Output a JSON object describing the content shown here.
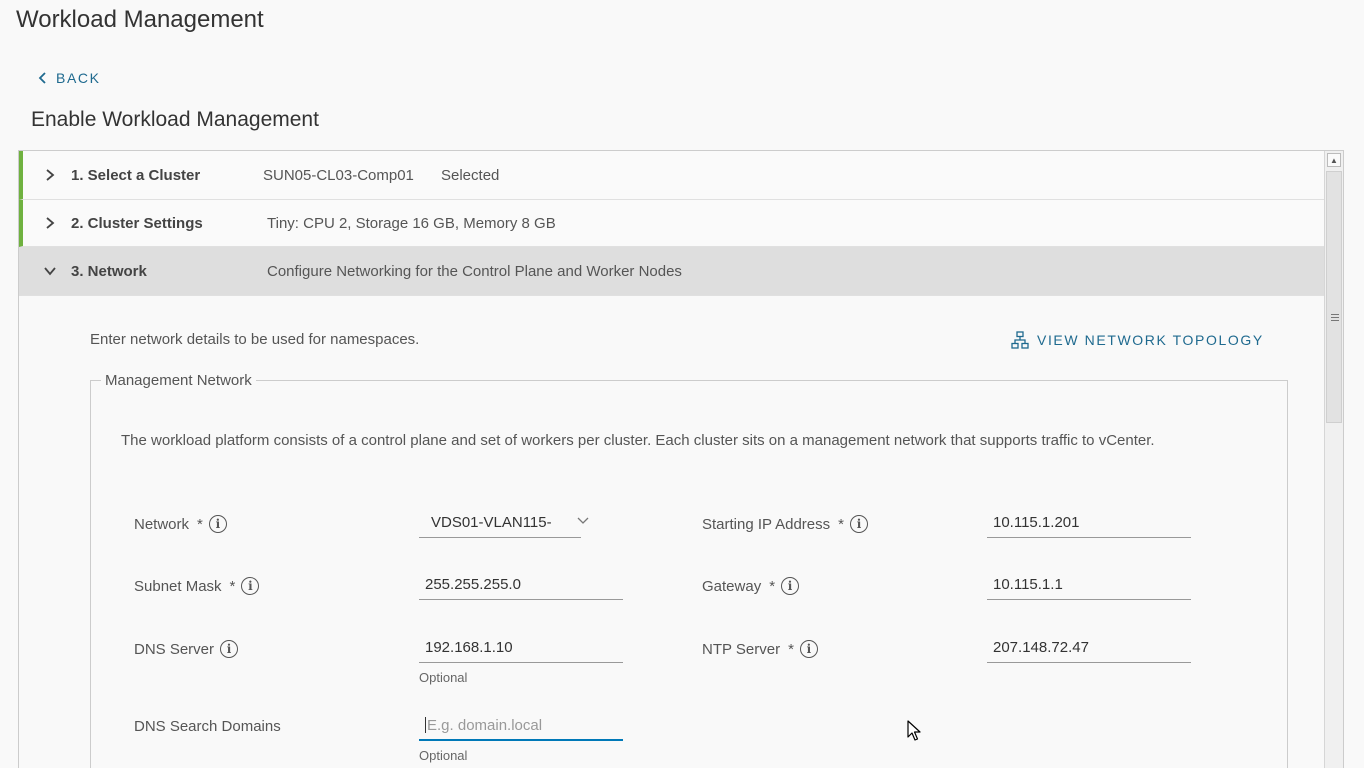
{
  "header": {
    "title": "Workload Management",
    "back_label": "BACK",
    "section_title": "Enable Workload Management"
  },
  "steps": [
    {
      "title": "1. Select a Cluster",
      "summary": "SUN05-CL03-Comp01",
      "status": "Selected"
    },
    {
      "title": "2. Cluster Settings",
      "summary": "Tiny: CPU 2, Storage 16 GB, Memory 8 GB"
    },
    {
      "title": "3. Network",
      "summary": "Configure Networking for the Control Plane and Worker Nodes"
    }
  ],
  "network": {
    "intro": "Enter network details to be used for namespaces.",
    "topology_link": "VIEW NETWORK TOPOLOGY",
    "fieldset_legend": "Management Network",
    "description": "The workload platform consists of a control plane and set of workers per cluster. Each cluster sits on a management network that supports traffic to vCenter.",
    "fields": {
      "network": {
        "label": "Network",
        "required": "*",
        "value": "VDS01-VLAN115-"
      },
      "starting_ip": {
        "label": "Starting IP Address",
        "required": "*",
        "value": "10.115.1.201"
      },
      "subnet_mask": {
        "label": "Subnet Mask",
        "required": "*",
        "value": "255.255.255.0"
      },
      "gateway": {
        "label": "Gateway",
        "required": "*",
        "value": "10.115.1.1"
      },
      "dns_server": {
        "label": "DNS Server",
        "value": "192.168.1.10",
        "helper": "Optional"
      },
      "ntp_server": {
        "label": "NTP Server",
        "required": "*",
        "value": "207.148.72.47"
      },
      "dns_search": {
        "label": "DNS Search Domains",
        "placeholder": "E.g. domain.local",
        "helper": "Optional"
      }
    }
  },
  "colors": {
    "accent": "#1f6a8f",
    "step_done": "#6fb13f",
    "focus": "#0079b8"
  },
  "icons": {
    "back": "chevron-left-icon",
    "step_collapsed": "chevron-right-icon",
    "step_expanded": "chevron-down-icon",
    "topology": "network-topology-icon",
    "info": "info-icon",
    "cursor": "mouse-pointer-icon"
  }
}
